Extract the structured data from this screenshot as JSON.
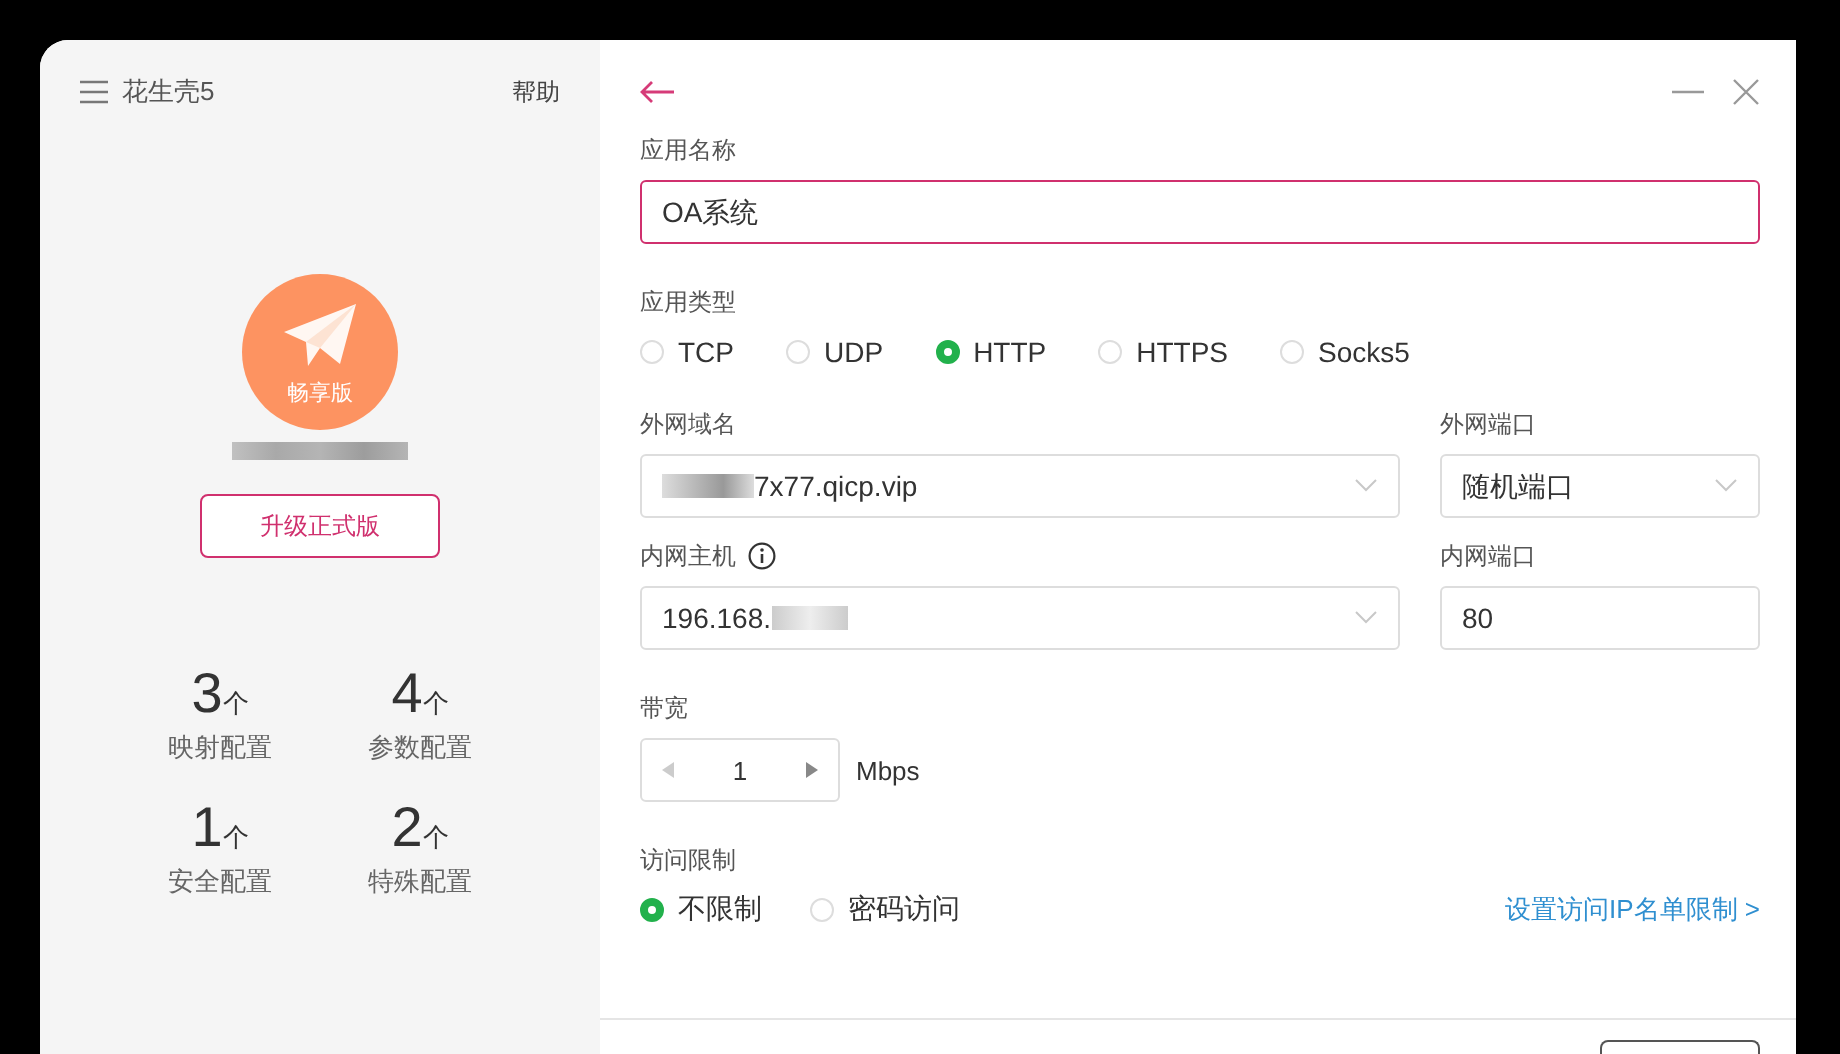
{
  "sidebar": {
    "app_title": "花生壳5",
    "help": "帮助",
    "badge": "畅享版",
    "upgrade_button": "升级正式版",
    "stats": [
      {
        "count": "3",
        "unit": "个",
        "label": "映射配置"
      },
      {
        "count": "4",
        "unit": "个",
        "label": "参数配置"
      },
      {
        "count": "1",
        "unit": "个",
        "label": "安全配置"
      },
      {
        "count": "2",
        "unit": "个",
        "label": "特殊配置"
      }
    ]
  },
  "form": {
    "app_name": {
      "label": "应用名称",
      "value": "OA系统",
      "focused": true
    },
    "app_type": {
      "label": "应用类型",
      "options": [
        {
          "label": "TCP",
          "selected": false
        },
        {
          "label": "UDP",
          "selected": false
        },
        {
          "label": "HTTP",
          "selected": true
        },
        {
          "label": "HTTPS",
          "selected": false
        },
        {
          "label": "Socks5",
          "selected": false
        }
      ]
    },
    "domain": {
      "label": "外网域名",
      "value": "7x77.qicp.vip"
    },
    "external_port": {
      "label": "外网端口",
      "value": "随机端口"
    },
    "host": {
      "label": "内网主机",
      "value": "196.168."
    },
    "internal_port": {
      "label": "内网端口",
      "value": "80"
    },
    "bandwidth": {
      "label": "带宽",
      "value": "1",
      "unit": "Mbps"
    },
    "access": {
      "label": "访问限制",
      "options": [
        {
          "label": "不限制",
          "selected": true
        },
        {
          "label": "密码访问",
          "selected": false
        }
      ],
      "link": "设置访问IP名单限制 >"
    }
  }
}
